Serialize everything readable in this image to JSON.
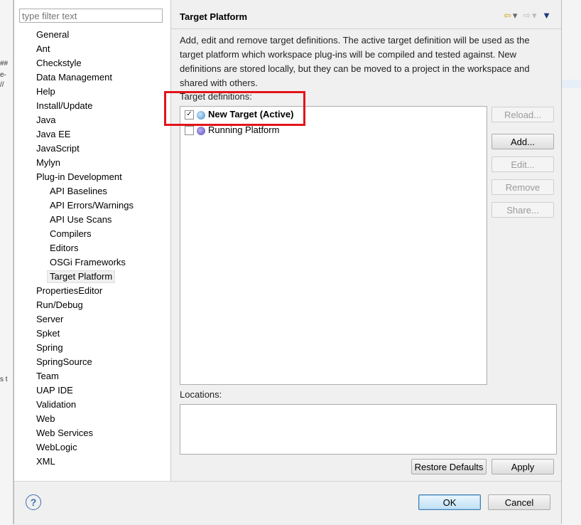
{
  "filter_placeholder": "type filter text",
  "tree": [
    {
      "label": "General",
      "indent": 0
    },
    {
      "label": "Ant",
      "indent": 0
    },
    {
      "label": "Checkstyle",
      "indent": 0
    },
    {
      "label": "Data Management",
      "indent": 0
    },
    {
      "label": "Help",
      "indent": 0
    },
    {
      "label": "Install/Update",
      "indent": 0
    },
    {
      "label": "Java",
      "indent": 0
    },
    {
      "label": "Java EE",
      "indent": 0
    },
    {
      "label": "JavaScript",
      "indent": 0
    },
    {
      "label": "Mylyn",
      "indent": 0
    },
    {
      "label": "Plug-in Development",
      "indent": 0
    },
    {
      "label": "API Baselines",
      "indent": 1
    },
    {
      "label": "API Errors/Warnings",
      "indent": 1
    },
    {
      "label": "API Use Scans",
      "indent": 1
    },
    {
      "label": "Compilers",
      "indent": 1
    },
    {
      "label": "Editors",
      "indent": 1
    },
    {
      "label": "OSGi Frameworks",
      "indent": 1
    },
    {
      "label": "Target Platform",
      "indent": 1,
      "selected": true
    },
    {
      "label": "PropertiesEditor",
      "indent": 0
    },
    {
      "label": "Run/Debug",
      "indent": 0
    },
    {
      "label": "Server",
      "indent": 0
    },
    {
      "label": "Spket",
      "indent": 0
    },
    {
      "label": "Spring",
      "indent": 0
    },
    {
      "label": "SpringSource",
      "indent": 0
    },
    {
      "label": "Team",
      "indent": 0
    },
    {
      "label": "UAP IDE",
      "indent": 0
    },
    {
      "label": "Validation",
      "indent": 0
    },
    {
      "label": "Web",
      "indent": 0
    },
    {
      "label": "Web Services",
      "indent": 0
    },
    {
      "label": "WebLogic",
      "indent": 0
    },
    {
      "label": "XML",
      "indent": 0
    }
  ],
  "page": {
    "title": "Target Platform",
    "description": "Add, edit and remove target definitions.  The active target definition will be used as the target platform which workspace plug-ins will be compiled and tested against.  New definitions are stored locally, but they can be moved to a project in the workspace and shared with others.",
    "target_definitions_label": "Target definitions:",
    "targets": [
      {
        "label": "New Target (Active)",
        "checked": true,
        "bold": true,
        "icon_color": "#3f8fcf"
      },
      {
        "label": "Running Platform",
        "checked": false,
        "bold": false,
        "icon_color": "#5a4fb8"
      }
    ],
    "buttons": {
      "reload": "Reload...",
      "add": "Add...",
      "edit": "Edit...",
      "remove": "Remove",
      "share": "Share..."
    },
    "locations_label": "Locations:",
    "restore_defaults": "Restore Defaults",
    "apply": "Apply"
  },
  "footer": {
    "help": "?",
    "ok": "OK",
    "cancel": "Cancel"
  },
  "background_fragments": [
    "##",
    "e-",
    "//",
    "s t"
  ],
  "colors": {
    "highlight": "#e3141b",
    "ok_border": "#3c7fb1"
  }
}
